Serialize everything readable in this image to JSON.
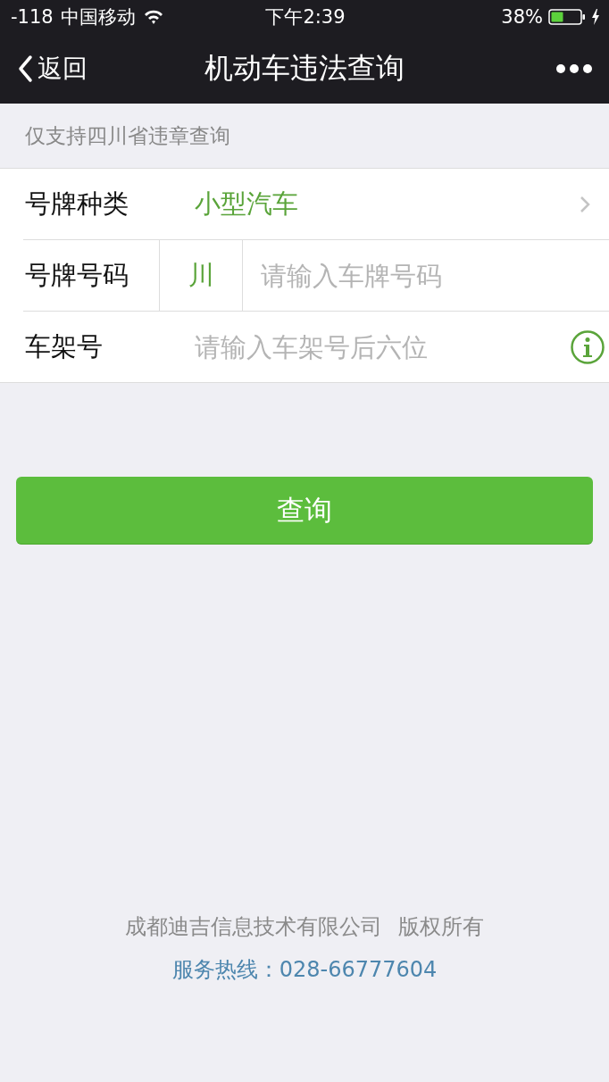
{
  "status_bar": {
    "signal": "-118",
    "carrier": "中国移动",
    "time": "下午2:39",
    "battery_percent": "38%",
    "charging": true
  },
  "nav": {
    "back_label": "返回",
    "title": "机动车违法查询"
  },
  "notice": "仅支持四川省违章查询",
  "form": {
    "rows": [
      {
        "kind": "select",
        "label": "号牌种类",
        "value": "小型汽车"
      },
      {
        "kind": "plate",
        "label": "号牌号码",
        "prefix": "川",
        "placeholder": "请输入车牌号码"
      },
      {
        "kind": "input",
        "label": "车架号",
        "placeholder": "请输入车架号后六位",
        "info": true
      }
    ]
  },
  "submit": "查询",
  "footer": {
    "copyright": "成都迪吉信息技术有限公司 版权所有",
    "hotline": "服务热线：028-66777604"
  }
}
